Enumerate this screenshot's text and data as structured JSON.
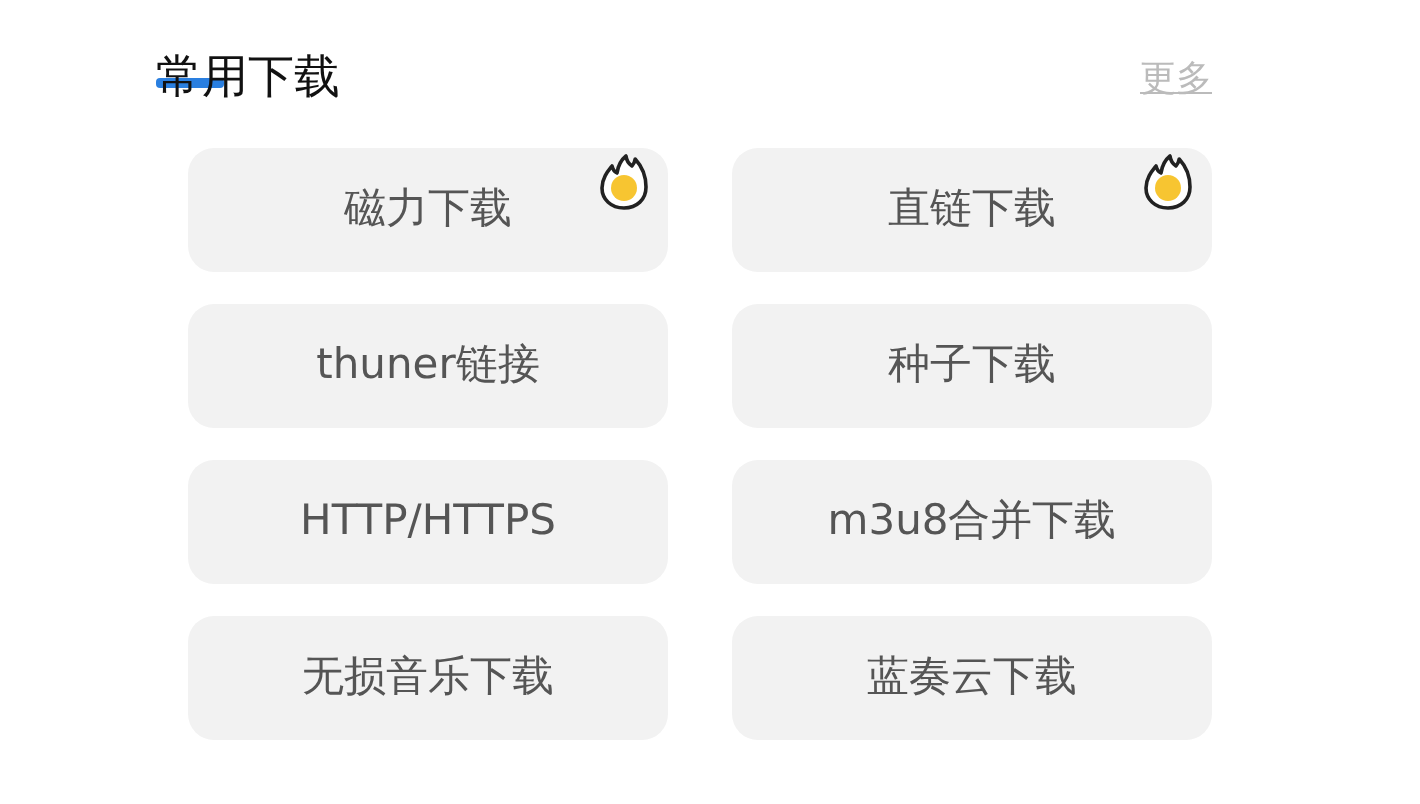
{
  "section": {
    "title": "常用下载",
    "more": "更多"
  },
  "items": [
    {
      "label": "磁力下载",
      "hot": true
    },
    {
      "label": "直链下载",
      "hot": true
    },
    {
      "label": "thuner链接",
      "hot": false
    },
    {
      "label": "种子下载",
      "hot": false
    },
    {
      "label": "HTTP/HTTPS",
      "hot": false
    },
    {
      "label": "m3u8合并下载",
      "hot": false
    },
    {
      "label": "无损音乐下载",
      "hot": false
    },
    {
      "label": "蓝奏云下载",
      "hot": false
    }
  ]
}
